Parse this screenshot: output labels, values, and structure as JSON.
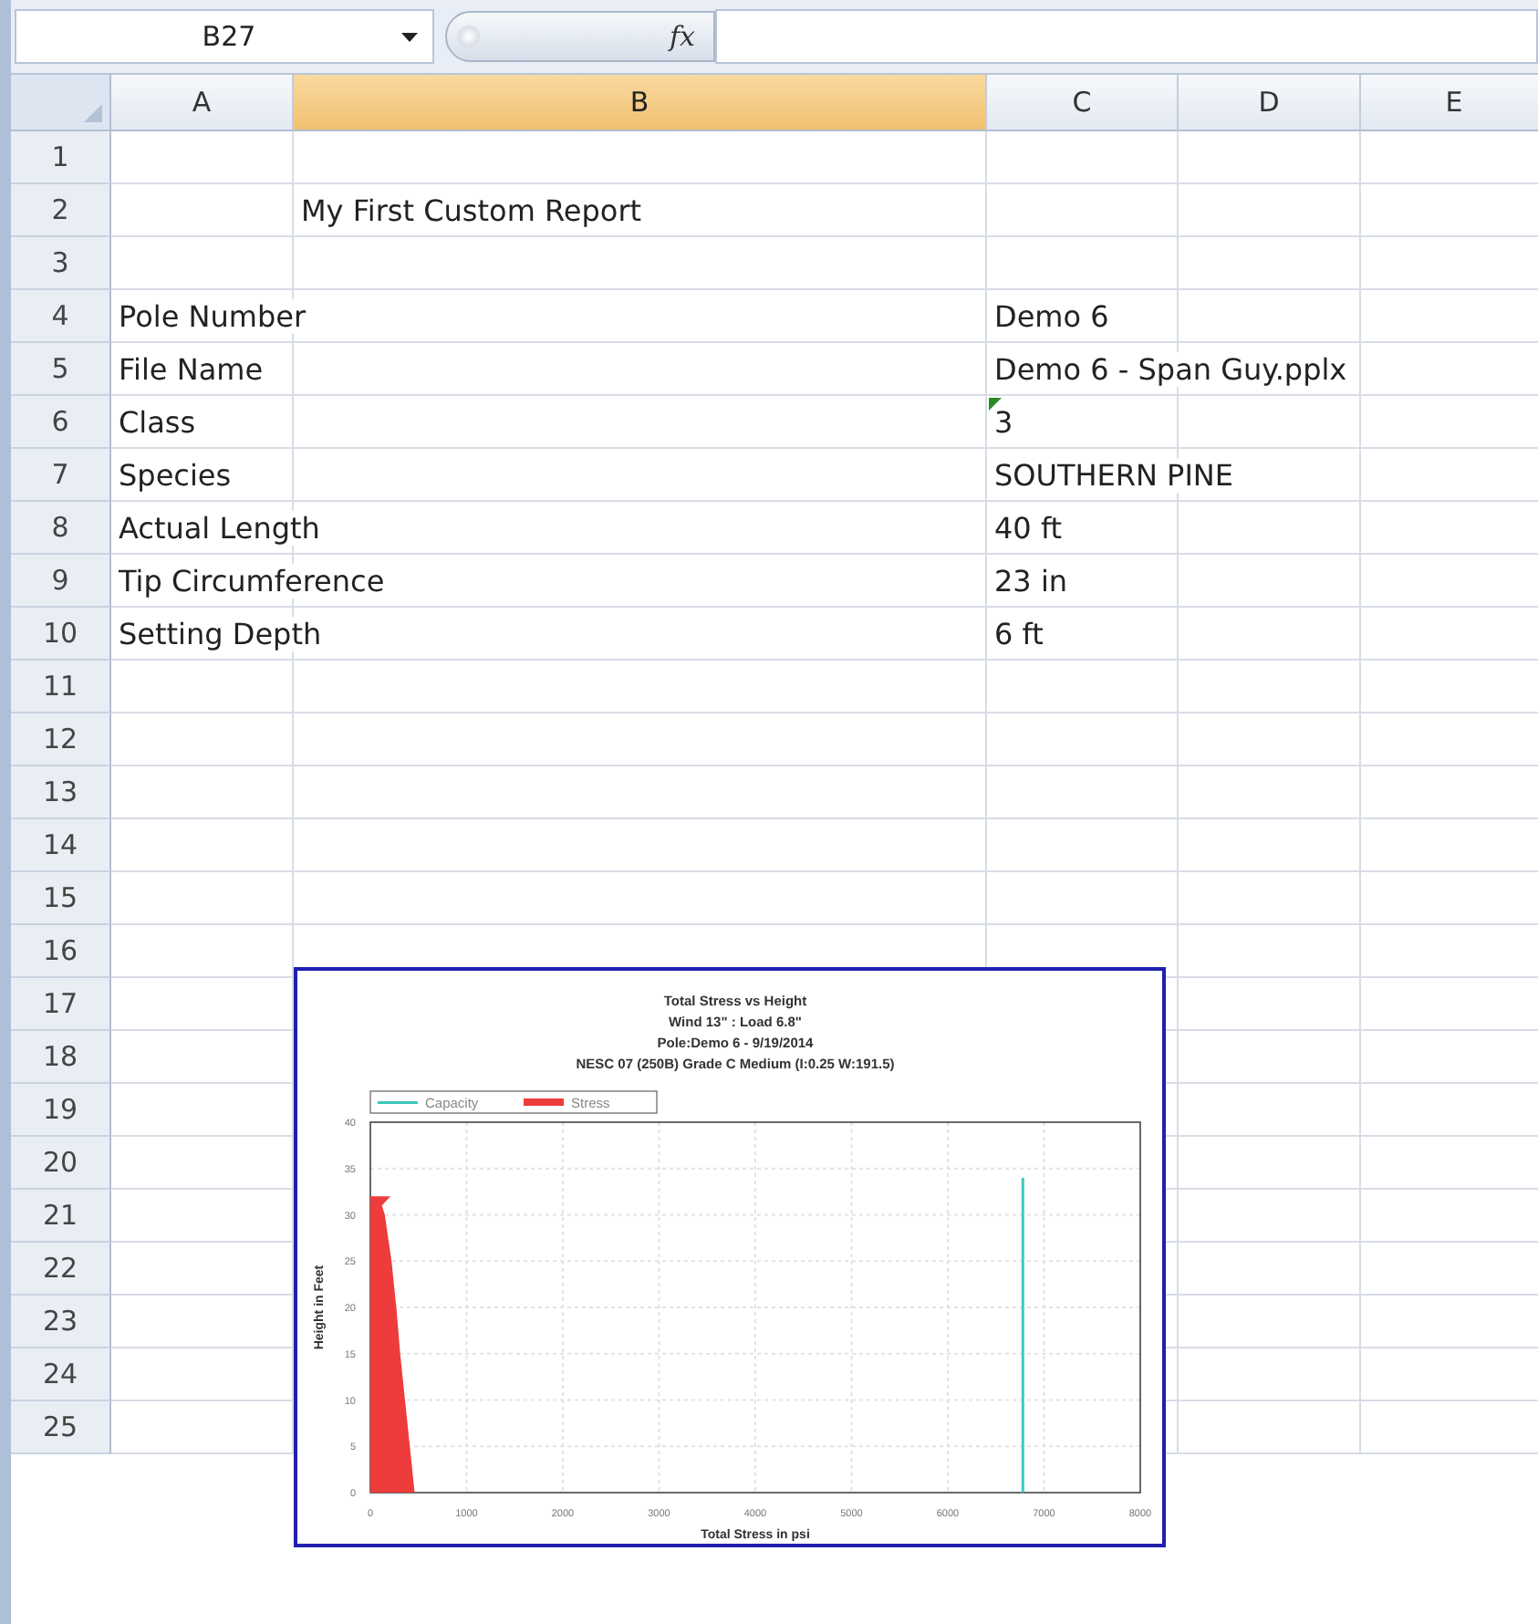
{
  "formula_bar": {
    "name_box": "B27",
    "function_label": "fx"
  },
  "columns": [
    {
      "label": "A",
      "selected": false
    },
    {
      "label": "B",
      "selected": true
    },
    {
      "label": "C",
      "selected": false
    },
    {
      "label": "D",
      "selected": false
    },
    {
      "label": "E",
      "selected": false
    }
  ],
  "rows": [
    {
      "header": "1"
    },
    {
      "header": "2",
      "B": {
        "text": "My First Custom Report",
        "error_flag": false
      }
    },
    {
      "header": "3"
    },
    {
      "header": "4",
      "A": {
        "text": "Pole Number",
        "error_flag": false
      },
      "C": {
        "text": "Demo 6",
        "error_flag": false
      }
    },
    {
      "header": "5",
      "A": {
        "text": "File Name",
        "error_flag": false
      },
      "C": {
        "text": "Demo 6 - Span Guy.pplx",
        "error_flag": false
      }
    },
    {
      "header": "6",
      "A": {
        "text": "Class",
        "error_flag": false
      },
      "C": {
        "text": "3",
        "error_flag": true
      }
    },
    {
      "header": "7",
      "A": {
        "text": "Species",
        "error_flag": false
      },
      "C": {
        "text": "SOUTHERN PINE",
        "error_flag": false
      }
    },
    {
      "header": "8",
      "A": {
        "text": "Actual Length",
        "error_flag": false
      },
      "C": {
        "text": "40 ft",
        "error_flag": false
      }
    },
    {
      "header": "9",
      "A": {
        "text": "Tip Circumference",
        "error_flag": false
      },
      "C": {
        "text": "23 in",
        "error_flag": false
      }
    },
    {
      "header": "10",
      "A": {
        "text": "Setting Depth",
        "error_flag": false
      },
      "C": {
        "text": "6 ft",
        "error_flag": false
      }
    },
    {
      "header": "11"
    },
    {
      "header": "12"
    },
    {
      "header": "13"
    },
    {
      "header": "14"
    },
    {
      "header": "15"
    },
    {
      "header": "16"
    },
    {
      "header": "17"
    },
    {
      "header": "18"
    },
    {
      "header": "19"
    },
    {
      "header": "20"
    },
    {
      "header": "21"
    },
    {
      "header": "22"
    },
    {
      "header": "23"
    },
    {
      "header": "24"
    },
    {
      "header": "25"
    }
  ],
  "chart": {
    "chart_data": {
      "type": "area",
      "orientation": "horizontal",
      "grid": true,
      "legend": "upper left",
      "title": [
        "Total Stress vs Height",
        "Wind 13\"  :  Load 6.8\"",
        "Pole:Demo 6  -  9/19/2014",
        "NESC  07 (250B) Grade C  Medium (I:0.25 W:191.5)"
      ],
      "xlabel": "Total Stress in psi",
      "ylabel": "Height in Feet",
      "x": [
        0,
        5,
        10,
        15,
        20,
        25,
        30,
        31,
        32,
        34
      ],
      "series": [
        {
          "name": "Capacity",
          "color": "#3cc8c0",
          "type": "line",
          "values": [
            6780,
            6780,
            6780,
            6780,
            6780,
            6780,
            6780,
            6780,
            6780,
            6780
          ]
        },
        {
          "name": "Stress",
          "color": "#ee3b3b",
          "type": "area",
          "values": [
            460,
            410,
            360,
            310,
            270,
            220,
            150,
            120,
            210,
            null
          ]
        }
      ],
      "xlim": [
        0,
        8000
      ],
      "ylim": [
        0,
        40
      ],
      "xticks": [
        0,
        1000,
        2000,
        3000,
        4000,
        5000,
        6000,
        7000,
        8000
      ],
      "yticks": [
        0,
        5,
        10,
        15,
        20,
        25,
        30,
        35,
        40
      ]
    }
  }
}
